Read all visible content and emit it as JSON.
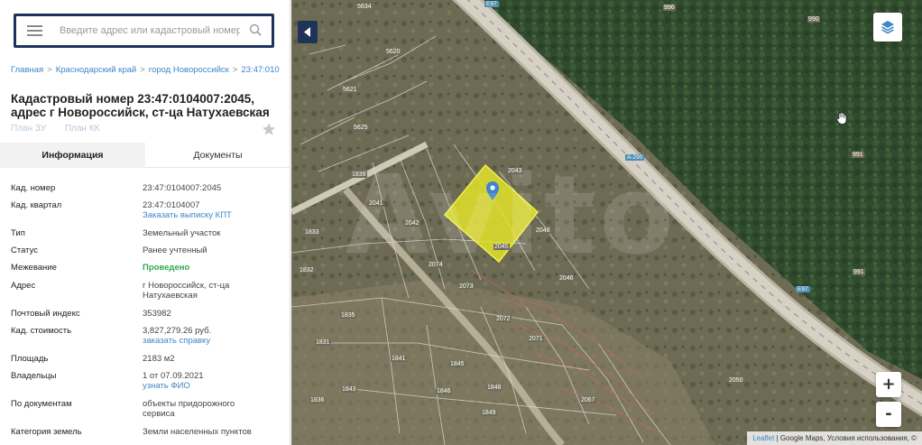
{
  "search": {
    "placeholder": "Введите адрес или кадастровый номер"
  },
  "breadcrumb": [
    "Главная",
    "Краснодарский край",
    "город Новороссийск",
    "23:47:010"
  ],
  "title": "Кадастровый номер 23:47:0104007:2045, адрес г Новороссийск, ст-ца Натухаевская",
  "plan_links": [
    "План ЗУ",
    "План КК"
  ],
  "tabs": [
    "Информация",
    "Документы"
  ],
  "rows": [
    {
      "key": "Кад. номер",
      "value": "23:47:0104007:2045"
    },
    {
      "key": "Кад. квартал",
      "value": "23:47:0104007",
      "link": "Заказать выписку КПТ"
    },
    {
      "key": "Тип",
      "value": "Земельный участок"
    },
    {
      "key": "Статус",
      "value": "Ранее учтенный"
    },
    {
      "key": "Межевание",
      "value": "Проведено"
    },
    {
      "key": "Адрес",
      "value": "г Новороссийск, ст-ца Натухаевская"
    },
    {
      "key": "Почтовый индекс",
      "value": "353982"
    },
    {
      "key": "Кад. стоимость",
      "value": "3,827,279.26 руб.",
      "link": "заказать справку"
    },
    {
      "key": "Площадь",
      "value": "2183 м2"
    },
    {
      "key": "Владельцы",
      "value": "1 от 07.09.2021",
      "link": "узнать ФИО"
    },
    {
      "key": "По документам",
      "value": "объекты придорожного сервиса"
    },
    {
      "key": "Категория земель",
      "value": "Земли населенных пунктов"
    }
  ],
  "map": {
    "zoom_in": "+",
    "zoom_out": "-",
    "attribution_leaflet": "Leaflet",
    "attribution_rest": " | Google Maps, Условия использования, ©",
    "watermark": "Avito",
    "road_labels": [
      "E97",
      "A-290",
      "E97"
    ],
    "plot_labels": [
      "5634",
      "996",
      "990",
      "5620",
      "5621",
      "2043",
      "2041",
      "2042",
      "2074",
      "2046",
      "2073",
      "2048",
      "2072",
      "2071",
      "2045",
      "1841",
      "1843",
      "1845",
      "1846",
      "1848",
      "1849",
      "1833",
      "1835",
      "1832",
      "1831",
      "2067",
      "2050",
      "991",
      "991",
      "5625",
      "1836",
      "1839"
    ]
  },
  "colors": {
    "navy": "#1e3358",
    "link": "#3e86c9",
    "green": "#2fa84f",
    "parcel": "#e6e62a"
  }
}
